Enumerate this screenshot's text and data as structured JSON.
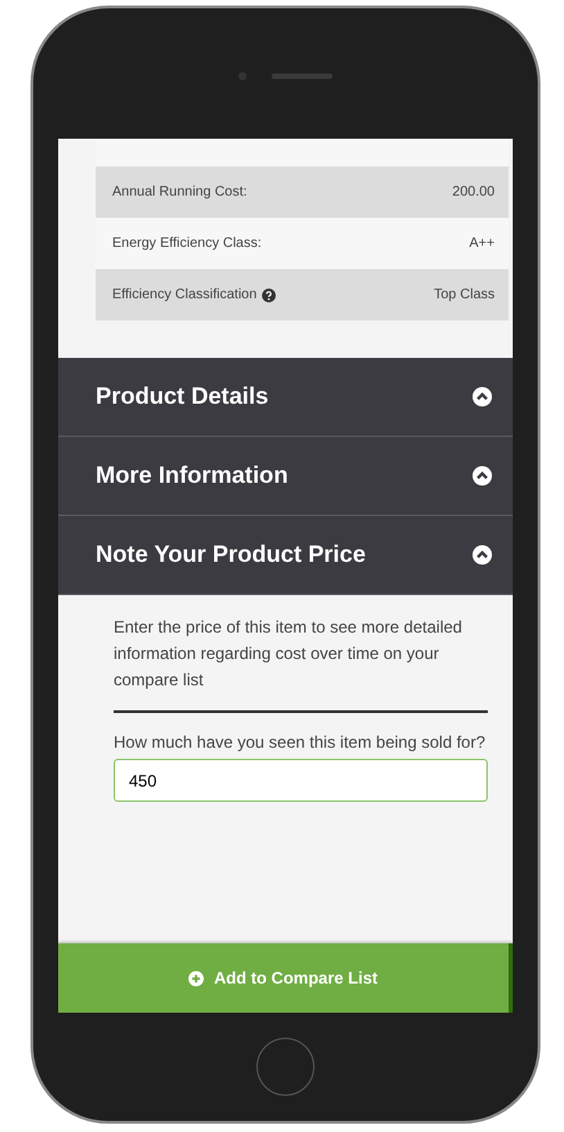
{
  "spec_table": {
    "rows": [
      {
        "label": "Annual Running Cost:",
        "value": "200.00"
      },
      {
        "label": "Energy Efficiency Class:",
        "value": "A++"
      },
      {
        "label": "Efficiency Classification",
        "value": "Top Class",
        "help": true
      }
    ]
  },
  "sections": [
    {
      "title": "Product Details"
    },
    {
      "title": "More Information"
    },
    {
      "title": "Note Your Product Price",
      "intro": "Enter the price of this item to see more detailed information regarding cost over time on your compare list",
      "question": "How much have you seen this item being sold for?",
      "value": "450"
    }
  ],
  "add_button": {
    "label": "Add to Compare List"
  }
}
